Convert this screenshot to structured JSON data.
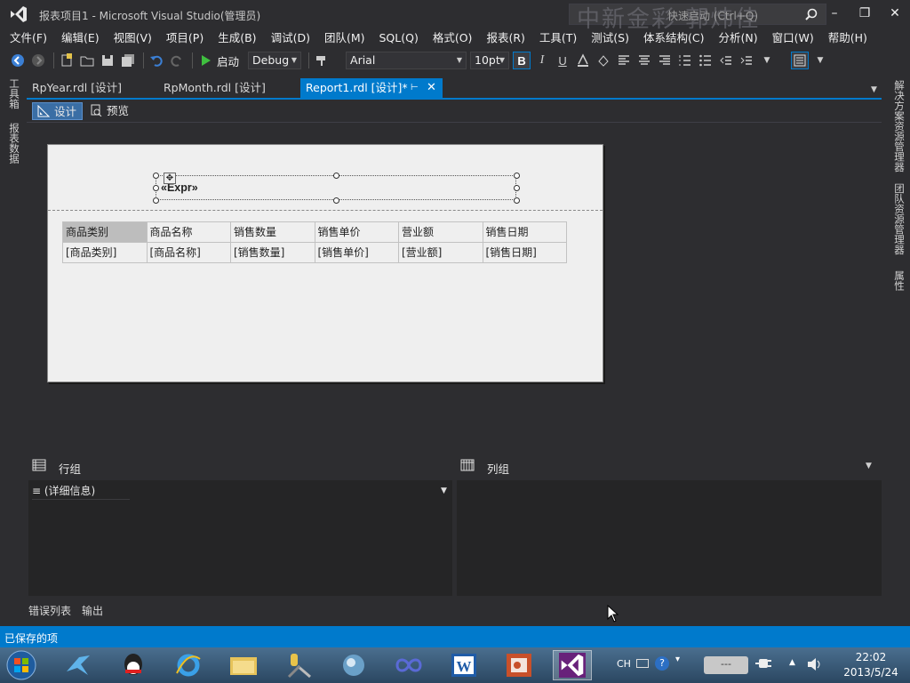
{
  "window": {
    "title": "报表项目1 - Microsoft Visual Studio(管理员)",
    "quick_launch": "快速启动 (Ctrl+Q)",
    "watermark": "中新金彩 郭炜佳"
  },
  "menu": [
    "文件(F)",
    "编辑(E)",
    "视图(V)",
    "项目(P)",
    "生成(B)",
    "调试(D)",
    "团队(M)",
    "SQL(Q)",
    "格式(O)",
    "报表(R)",
    "工具(T)",
    "测试(S)",
    "体系结构(C)",
    "分析(N)",
    "窗口(W)",
    "帮助(H)"
  ],
  "toolbar": {
    "start_label": "启动",
    "config": "Debug",
    "font_name": "Arial",
    "font_size": "10pt",
    "bold": "B",
    "italic": "I",
    "underline": "U"
  },
  "left_side_tabs": [
    "工具箱",
    "报表数据"
  ],
  "right_side_tabs": [
    "解决方案资源管理器",
    "团队资源管理器",
    "属性"
  ],
  "doc_tabs": [
    {
      "label": "RpYear.rdl [设计]",
      "active": false
    },
    {
      "label": "RpMonth.rdl [设计]",
      "active": false
    },
    {
      "label": "Report1.rdl [设计]*",
      "active": true
    }
  ],
  "view_buttons": {
    "design": "设计",
    "preview": "预览"
  },
  "report": {
    "header_textbox": "«Expr»",
    "table_headers": [
      "商品类别",
      "商品名称",
      "销售数量",
      "销售单价",
      "营业额",
      "销售日期"
    ],
    "table_fields": [
      "[商品类别]",
      "[商品名称]",
      "[销售数量]",
      "[销售单价]",
      "[营业额]",
      "[销售日期]"
    ]
  },
  "grouping": {
    "row_groups_title": "行组",
    "column_groups_title": "列组",
    "row_group_item": "≡ (详细信息)"
  },
  "bottom_tabs": [
    "错误列表",
    "输出"
  ],
  "status": "已保存的项",
  "tray": {
    "lang": "CH",
    "time": "22:02",
    "date": "2013/5/24"
  },
  "colors": {
    "accent": "#007acc",
    "background": "#2d2d30",
    "canvas": "#efefef"
  }
}
